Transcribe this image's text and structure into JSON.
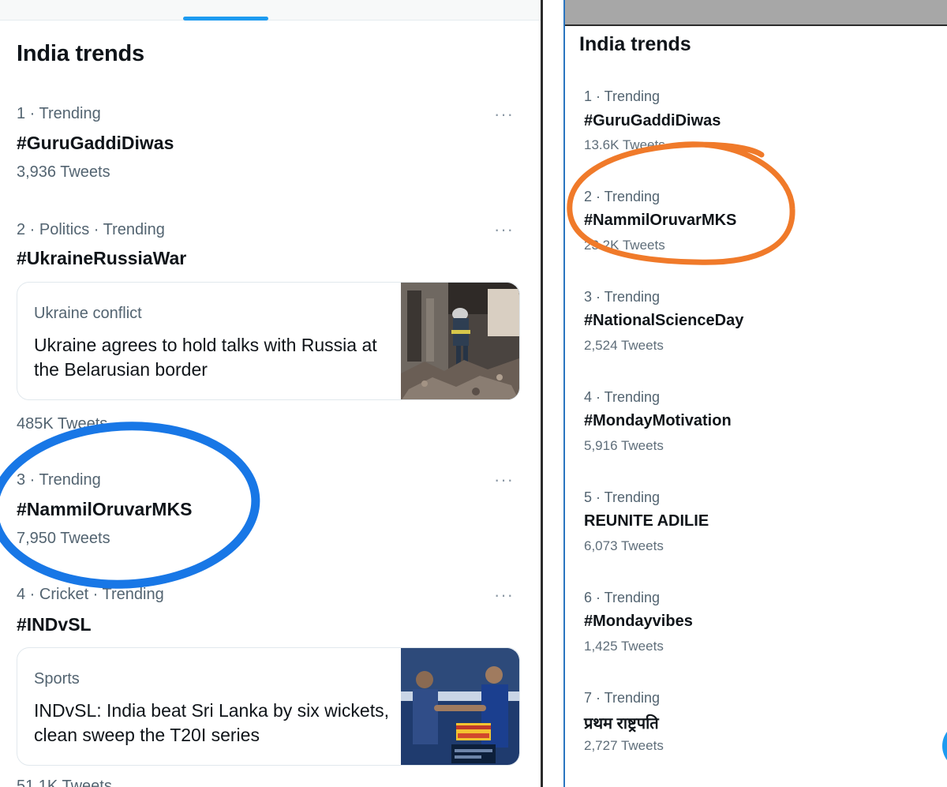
{
  "colors": {
    "accent": "#1d9bf0",
    "blue_circle": "#1877e6",
    "orange_circle": "#f07a2a",
    "text_primary": "#0f1419",
    "text_secondary": "#536471"
  },
  "left": {
    "heading": "India trends",
    "more_icon": "more-horizontal-icon",
    "trends": [
      {
        "meta": "1 · Trending",
        "name": "#GuruGaddiDiwas",
        "tweets": "3,936 Tweets"
      },
      {
        "meta": "2 · Politics · Trending",
        "name": "#UkraineRussiaWar",
        "tweets": "485K Tweets"
      },
      {
        "meta": "3 · Trending",
        "name": "#NammilOruvarMKS",
        "tweets": "7,950 Tweets"
      },
      {
        "meta": "4 · Cricket · Trending",
        "name": "#INDvSL",
        "tweets": "51.1K Tweets"
      }
    ],
    "news": [
      {
        "category": "Ukraine conflict",
        "headline": "Ukraine agrees to hold talks with Russia at the Belarusian border"
      },
      {
        "category": "Sports",
        "headline": "INDvSL: India beat Sri Lanka by six wickets, clean sweep the T20I series"
      }
    ]
  },
  "right": {
    "heading": "India trends",
    "trends": [
      {
        "meta": "1 · Trending",
        "name": "#GuruGaddiDiwas",
        "tweets": "13.6K Tweets"
      },
      {
        "meta": "2 · Trending",
        "name": "#NammilOruvarMKS",
        "tweets": "23.2K Tweets"
      },
      {
        "meta": "3 · Trending",
        "name": "#NationalScienceDay",
        "tweets": "2,524 Tweets"
      },
      {
        "meta": "4 · Trending",
        "name": "#MondayMotivation",
        "tweets": "5,916 Tweets"
      },
      {
        "meta": "5 · Trending",
        "name": "REUNITE ADILIE",
        "tweets": "6,073 Tweets"
      },
      {
        "meta": "6 · Trending",
        "name": "#Mondayvibes",
        "tweets": "1,425 Tweets"
      },
      {
        "meta": "7 · Trending",
        "name": "प्रथम राष्ट्रपति",
        "tweets": "2,727 Tweets"
      }
    ]
  }
}
